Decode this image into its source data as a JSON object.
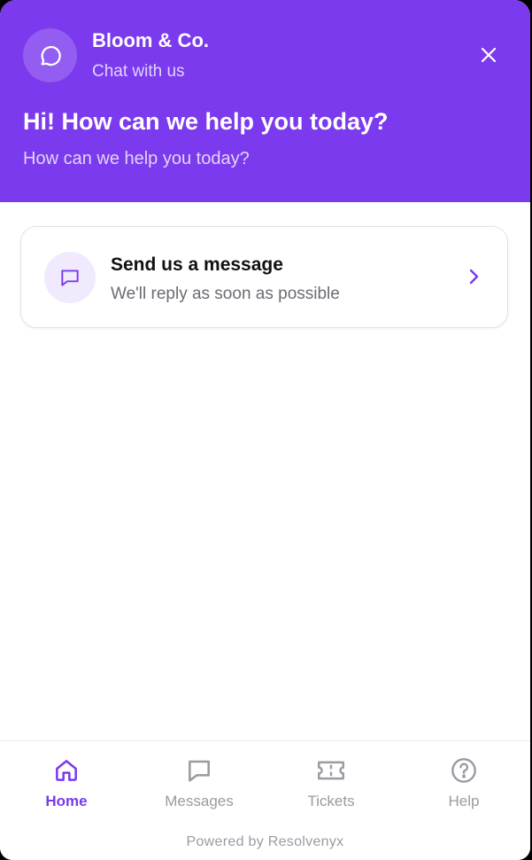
{
  "header": {
    "brand_name": "Bloom & Co.",
    "brand_subtitle": "Chat with us",
    "greeting": "Hi! How can we help you today?",
    "greeting_sub": "How can we help you today?"
  },
  "message_card": {
    "title": "Send us a message",
    "subtitle": "We'll reply as soon as possible"
  },
  "nav": {
    "items": [
      {
        "label": "Home",
        "icon": "home-icon",
        "active": true
      },
      {
        "label": "Messages",
        "icon": "chat-bubble-icon",
        "active": false
      },
      {
        "label": "Tickets",
        "icon": "ticket-icon",
        "active": false
      },
      {
        "label": "Help",
        "icon": "question-circle-icon",
        "active": false
      }
    ]
  },
  "footer": {
    "powered_by": "Powered by Resolvenyx"
  },
  "colors": {
    "accent": "#7b3aed",
    "muted": "#9a9aa3",
    "card_icon_bg": "#f1e9fe"
  }
}
